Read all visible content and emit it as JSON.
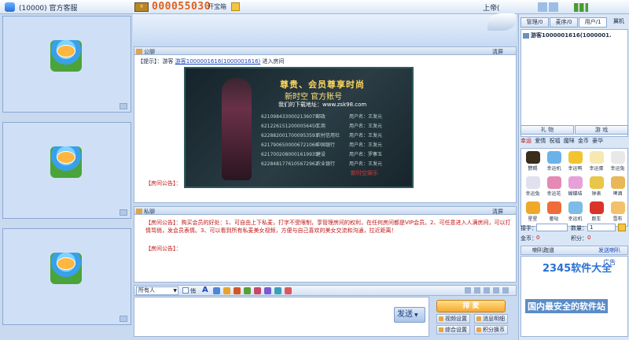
{
  "titlebar": {
    "app_title": "(10000) 官方客服",
    "coin_count": "000055030",
    "open_box": "开宝箱",
    "user_label": "上帝("
  },
  "public_chat": {
    "header": "公聊",
    "clear": "清屏",
    "tip_label": "【提示】：游客",
    "tip_user": "游客1000001616(1000001616)",
    "tip_suffix": "进入房间",
    "ad": {
      "title": "尊贵、会员尊享时尚",
      "subtitle": "新时空 官方账号",
      "url": "我们的下载地址：www.zsk98.com",
      "accounts": [
        {
          "no": "6210984330002136075",
          "bank": "邮政",
          "name": "用户名：王发元"
        },
        {
          "no": "6212261512000056450",
          "bank": "工商",
          "name": "用户名：王发元"
        },
        {
          "no": "6228820017000953593",
          "bank": "农村信用社",
          "name": "用户名：王发元"
        },
        {
          "no": "6217906500006721060",
          "bank": "中国银行",
          "name": "用户名：王发元"
        },
        {
          "no": "6217002080001619935",
          "bank": "建设",
          "name": "用户名：罗寨玉"
        },
        {
          "no": "6228481776105672962",
          "bank": "农业银行",
          "name": "用户名：王发元"
        }
      ],
      "footer": "新时空娱乐"
    },
    "notice_label": "【房间公告】："
  },
  "private_chat": {
    "header": "私聊",
    "clear": "清屏",
    "notice_text": "【房间公告】：购买会员的好处：1、可自由上下私麦，打字不受限制，享管理房间的权利，在任何房间都是VIP会员。2、可任意进入人满房间，可以打情骂俏，发会员表情。3、可以看到所有私麦美女视频，方便与自己喜欢的美女交流和沟通，拉近距离！",
    "notice_label2": "【房间公告】："
  },
  "toolbar": {
    "to_select": "所有人",
    "whisper": "悄",
    "font_icon": "A"
  },
  "input": {
    "send_label": "发送"
  },
  "actions": {
    "stage_button": "排 麦",
    "video_settings": "视频设置",
    "message_log": "消息明细",
    "general_settings": "综合设置",
    "points_exchange": "积分换币"
  },
  "right_panel": {
    "tabs": [
      "管理/0",
      "麦序/0",
      "用户/1"
    ],
    "plane_label": "翼机",
    "user_row": "游客1000001616(1000001.",
    "gift_tabs": [
      "礼 物",
      "游 戏"
    ],
    "categories": [
      "幸运",
      "爱情",
      "祝福",
      "魔咪",
      "金币",
      "豪华"
    ],
    "gifts": [
      "鬱赐",
      "幸运机",
      "幸运鸭",
      "幸运蛋",
      "幸运兔",
      "幸运兔",
      "幸运花",
      "蝴蝶结",
      "钟表",
      "啤酒",
      "星星",
      "奢哒",
      "幸运机",
      "跑车",
      "雪布"
    ],
    "qty_label": "接手：",
    "qty_count_label": "数量：",
    "qty_value": "1",
    "coins_label": "金币：",
    "coins_value": "0",
    "points_label": "积分：",
    "points_value": "0",
    "chat_mode": "喇叭跑道",
    "send_speaker": "发送喇叭",
    "ads_label": "广告"
  },
  "watermark": {
    "line1": "2345软件大全",
    "line2": "国内最安全的软件站"
  }
}
